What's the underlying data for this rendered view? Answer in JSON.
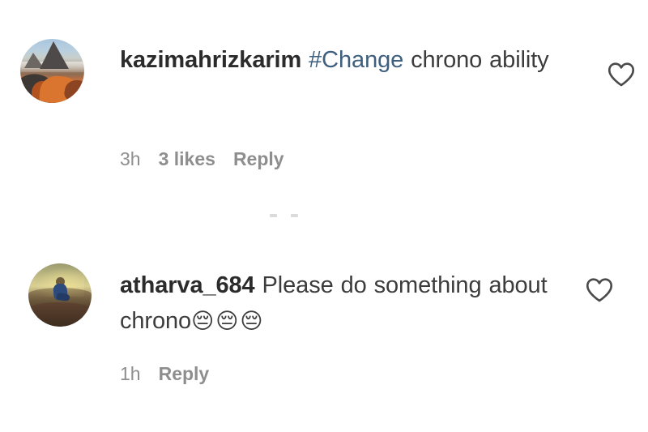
{
  "app": {
    "name": "instagram-comments",
    "background_color": "#ffffff",
    "text_color": "#3c3c3c",
    "username_color": "#2b2b2b",
    "link_color": "#3e5f7e",
    "meta_color": "#8e8e8e"
  },
  "comments": [
    {
      "username": "kazimahrizkarim",
      "hashtag": "#Change",
      "text": " chrono ability",
      "avatar_alt": "desert-mesa-landscape",
      "meta": {
        "time": "3h",
        "likes": "3 likes",
        "reply": "Reply"
      },
      "like_icon": "heart-outline-icon",
      "liked": false
    },
    {
      "username": "atharva_684",
      "hashtag": "",
      "text": " Please do something about chrono",
      "emojis": "😔😔😔",
      "avatar_alt": "person-sitting-in-field-at-dusk",
      "meta": {
        "time": "1h",
        "likes": "",
        "reply": "Reply"
      },
      "like_icon": "heart-outline-icon",
      "liked": false
    }
  ]
}
